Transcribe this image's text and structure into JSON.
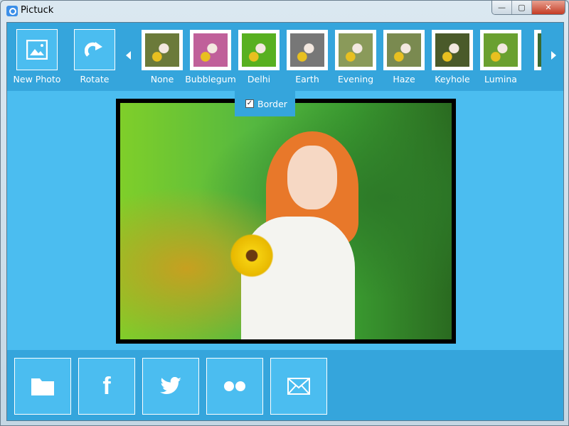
{
  "window": {
    "title": "Pictuck",
    "minimize": "—",
    "maximize": "▢",
    "close": "✕"
  },
  "toolbar": {
    "new_photo": "New Photo",
    "rotate": "Rotate"
  },
  "filters": [
    {
      "label": "None",
      "tint": "#6b7a3a"
    },
    {
      "label": "Bubblegum",
      "tint": "#c0609a"
    },
    {
      "label": "Delhi",
      "tint": "#58b020"
    },
    {
      "label": "Earth",
      "tint": "#777777"
    },
    {
      "label": "Evening",
      "tint": "#8a9a5a"
    },
    {
      "label": "Haze",
      "tint": "#7a8a50"
    },
    {
      "label": "Keyhole",
      "tint": "#4a5a2a"
    },
    {
      "label": "Lumina",
      "tint": "#6aa030"
    }
  ],
  "border_option": {
    "label": "Border",
    "checked": true
  },
  "share": [
    "folder-icon",
    "facebook-icon",
    "twitter-icon",
    "flickr-icon",
    "email-icon"
  ],
  "colors": {
    "toolbar": "#35a5dc",
    "panel": "#4bbdf0"
  }
}
